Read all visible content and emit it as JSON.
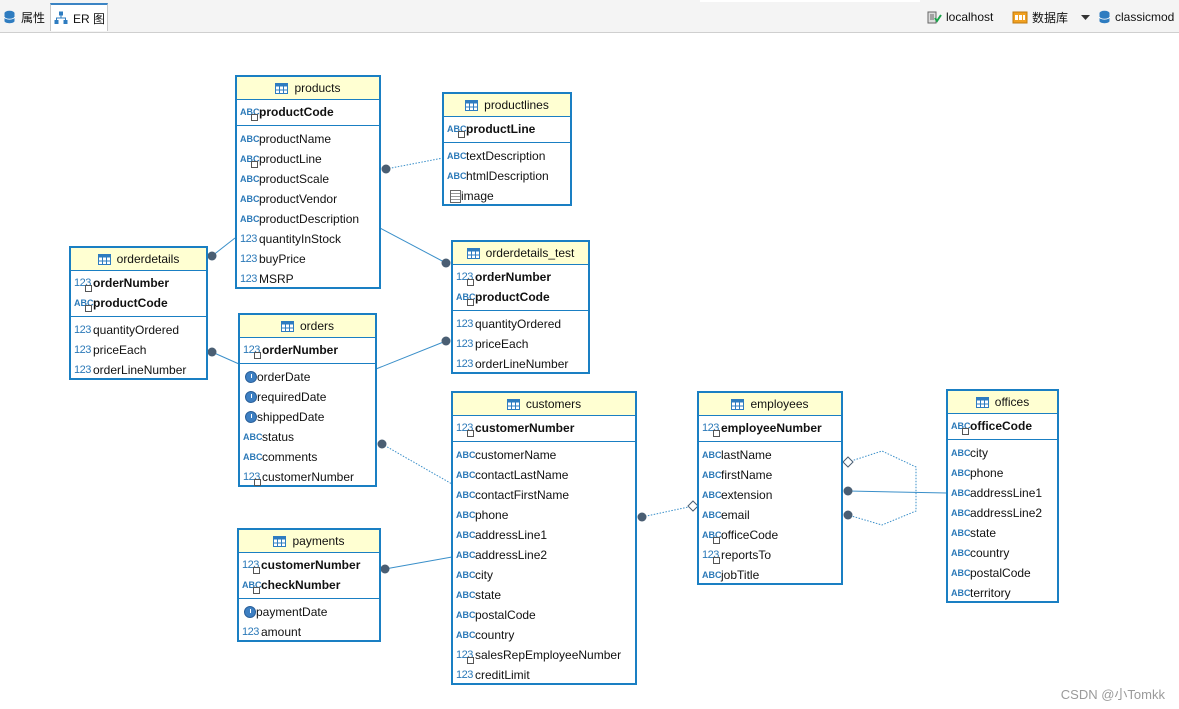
{
  "toolbar": {
    "tabs": [
      {
        "label": "属性",
        "active": false
      },
      {
        "label": "ER 图",
        "active": true
      }
    ],
    "connection": {
      "host": "localhost",
      "database_label": "数据库",
      "schema": "classicmod"
    }
  },
  "entities": {
    "products": {
      "name": "products",
      "keys": [
        {
          "name": "productCode",
          "type": "ABC"
        }
      ],
      "attrs": [
        {
          "name": "productName",
          "type": "ABC"
        },
        {
          "name": "productLine",
          "type": "ABC"
        },
        {
          "name": "productScale",
          "type": "ABC"
        },
        {
          "name": "productVendor",
          "type": "ABC"
        },
        {
          "name": "productDescription",
          "type": "ABC"
        },
        {
          "name": "quantityInStock",
          "type": "123"
        },
        {
          "name": "buyPrice",
          "type": "123"
        },
        {
          "name": "MSRP",
          "type": "123"
        }
      ]
    },
    "productlines": {
      "name": "productlines",
      "keys": [
        {
          "name": "productLine",
          "type": "ABC"
        }
      ],
      "attrs": [
        {
          "name": "textDescription",
          "type": "ABC"
        },
        {
          "name": "htmlDescription",
          "type": "ABC"
        },
        {
          "name": "image",
          "type": "doc"
        }
      ]
    },
    "orderdetails": {
      "name": "orderdetails",
      "keys": [
        {
          "name": "orderNumber",
          "type": "123"
        },
        {
          "name": "productCode",
          "type": "ABC"
        }
      ],
      "attrs": [
        {
          "name": "quantityOrdered",
          "type": "123"
        },
        {
          "name": "priceEach",
          "type": "123"
        },
        {
          "name": "orderLineNumber",
          "type": "123"
        }
      ]
    },
    "orderdetails_test": {
      "name": "orderdetails_test",
      "keys": [
        {
          "name": "orderNumber",
          "type": "123"
        },
        {
          "name": "productCode",
          "type": "ABC"
        }
      ],
      "attrs": [
        {
          "name": "quantityOrdered",
          "type": "123"
        },
        {
          "name": "priceEach",
          "type": "123"
        },
        {
          "name": "orderLineNumber",
          "type": "123"
        }
      ]
    },
    "orders": {
      "name": "orders",
      "keys": [
        {
          "name": "orderNumber",
          "type": "123"
        }
      ],
      "attrs": [
        {
          "name": "orderDate",
          "type": "date"
        },
        {
          "name": "requiredDate",
          "type": "date"
        },
        {
          "name": "shippedDate",
          "type": "date"
        },
        {
          "name": "status",
          "type": "ABC"
        },
        {
          "name": "comments",
          "type": "ABC"
        },
        {
          "name": "customerNumber",
          "type": "123"
        }
      ]
    },
    "customers": {
      "name": "customers",
      "keys": [
        {
          "name": "customerNumber",
          "type": "123"
        }
      ],
      "attrs": [
        {
          "name": "customerName",
          "type": "ABC"
        },
        {
          "name": "contactLastName",
          "type": "ABC"
        },
        {
          "name": "contactFirstName",
          "type": "ABC"
        },
        {
          "name": "phone",
          "type": "ABC"
        },
        {
          "name": "addressLine1",
          "type": "ABC"
        },
        {
          "name": "addressLine2",
          "type": "ABC"
        },
        {
          "name": "city",
          "type": "ABC"
        },
        {
          "name": "state",
          "type": "ABC"
        },
        {
          "name": "postalCode",
          "type": "ABC"
        },
        {
          "name": "country",
          "type": "ABC"
        },
        {
          "name": "salesRepEmployeeNumber",
          "type": "123"
        },
        {
          "name": "creditLimit",
          "type": "123"
        }
      ]
    },
    "payments": {
      "name": "payments",
      "keys": [
        {
          "name": "customerNumber",
          "type": "123"
        },
        {
          "name": "checkNumber",
          "type": "ABC"
        }
      ],
      "attrs": [
        {
          "name": "paymentDate",
          "type": "date"
        },
        {
          "name": "amount",
          "type": "123"
        }
      ]
    },
    "employees": {
      "name": "employees",
      "keys": [
        {
          "name": "employeeNumber",
          "type": "123"
        }
      ],
      "attrs": [
        {
          "name": "lastName",
          "type": "ABC"
        },
        {
          "name": "firstName",
          "type": "ABC"
        },
        {
          "name": "extension",
          "type": "ABC"
        },
        {
          "name": "email",
          "type": "ABC"
        },
        {
          "name": "officeCode",
          "type": "ABC"
        },
        {
          "name": "reportsTo",
          "type": "123"
        },
        {
          "name": "jobTitle",
          "type": "ABC"
        }
      ]
    },
    "offices": {
      "name": "offices",
      "keys": [
        {
          "name": "officeCode",
          "type": "ABC"
        }
      ],
      "attrs": [
        {
          "name": "city",
          "type": "ABC"
        },
        {
          "name": "phone",
          "type": "ABC"
        },
        {
          "name": "addressLine1",
          "type": "ABC"
        },
        {
          "name": "addressLine2",
          "type": "ABC"
        },
        {
          "name": "state",
          "type": "ABC"
        },
        {
          "name": "country",
          "type": "ABC"
        },
        {
          "name": "postalCode",
          "type": "ABC"
        },
        {
          "name": "territory",
          "type": "ABC"
        }
      ]
    }
  },
  "watermark": "CSDN @小Tomkk"
}
